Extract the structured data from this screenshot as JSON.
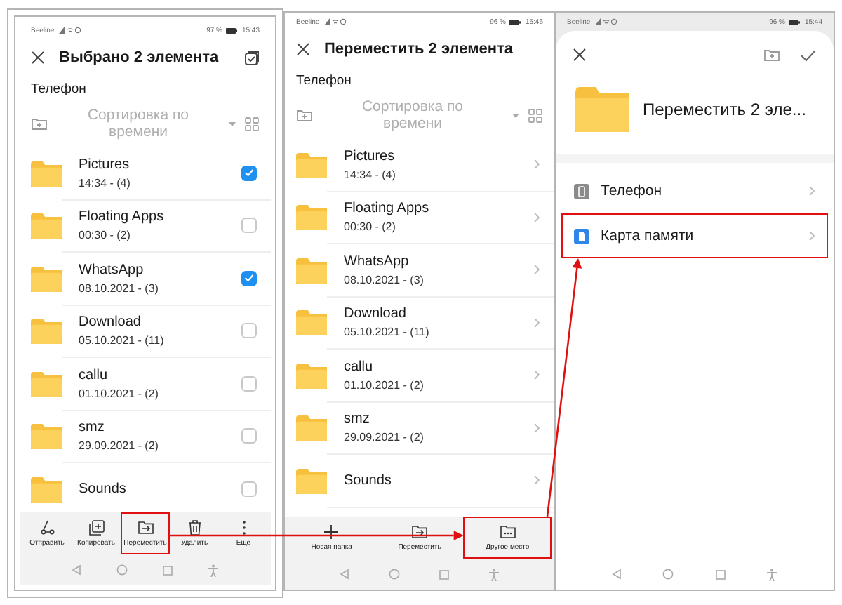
{
  "screens": [
    {
      "kind": "select",
      "status": {
        "carrier": "Beeline",
        "battery": "97 %",
        "time": "15:43"
      },
      "title": "Выбрано 2 элемента",
      "location": "Телефон",
      "sort": "Сортировка по времени",
      "folders": [
        {
          "name": "Pictures",
          "meta": "14:34 - (4)",
          "checked": true
        },
        {
          "name": "Floating Apps",
          "meta": "00:30 - (2)",
          "checked": false
        },
        {
          "name": "WhatsApp",
          "meta": "08.10.2021 - (3)",
          "checked": true
        },
        {
          "name": "Download",
          "meta": "05.10.2021 - (11)",
          "checked": false
        },
        {
          "name": "callu",
          "meta": "01.10.2021 - (2)",
          "checked": false
        },
        {
          "name": "smz",
          "meta": "29.09.2021 - (2)",
          "checked": false
        },
        {
          "name": "Sounds",
          "checked": false
        }
      ],
      "actions": [
        {
          "label": "Отправить",
          "kind": "share",
          "highlighted": false
        },
        {
          "label": "Копировать",
          "kind": "copy",
          "highlighted": false
        },
        {
          "label": "Переместить",
          "kind": "move",
          "highlighted": true
        },
        {
          "label": "Удалить",
          "kind": "delete",
          "highlighted": false
        },
        {
          "label": "Еще",
          "kind": "more",
          "highlighted": false
        }
      ]
    },
    {
      "kind": "move",
      "status": {
        "carrier": "Beeline",
        "battery": "96 %",
        "time": "15:46"
      },
      "title": "Переместить 2 элемента",
      "location": "Телефон",
      "sort": "Сортировка по времени",
      "folders": [
        {
          "name": "Pictures",
          "meta": "14:34 - (4)"
        },
        {
          "name": "Floating Apps",
          "meta": "00:30 - (2)"
        },
        {
          "name": "WhatsApp",
          "meta": "08.10.2021 - (3)"
        },
        {
          "name": "Download",
          "meta": "05.10.2021 - (11)"
        },
        {
          "name": "callu",
          "meta": "01.10.2021 - (2)"
        },
        {
          "name": "smz",
          "meta": "29.09.2021 - (2)"
        },
        {
          "name": "Sounds"
        }
      ],
      "actions": [
        {
          "label": "Новая папка",
          "kind": "new",
          "highlighted": false
        },
        {
          "label": "Переместить",
          "kind": "move",
          "highlighted": false
        },
        {
          "label": "Другое место",
          "kind": "other",
          "highlighted": true
        }
      ]
    },
    {
      "kind": "destination",
      "status": {
        "carrier": "Beeline",
        "battery": "96 %",
        "time": "15:44"
      },
      "title": "Переместить 2 эле...",
      "locations": [
        {
          "name": "Телефон",
          "kind": "phone",
          "highlighted": false
        },
        {
          "name": "Карта памяти",
          "kind": "sdcard",
          "highlighted": true
        }
      ]
    }
  ]
}
